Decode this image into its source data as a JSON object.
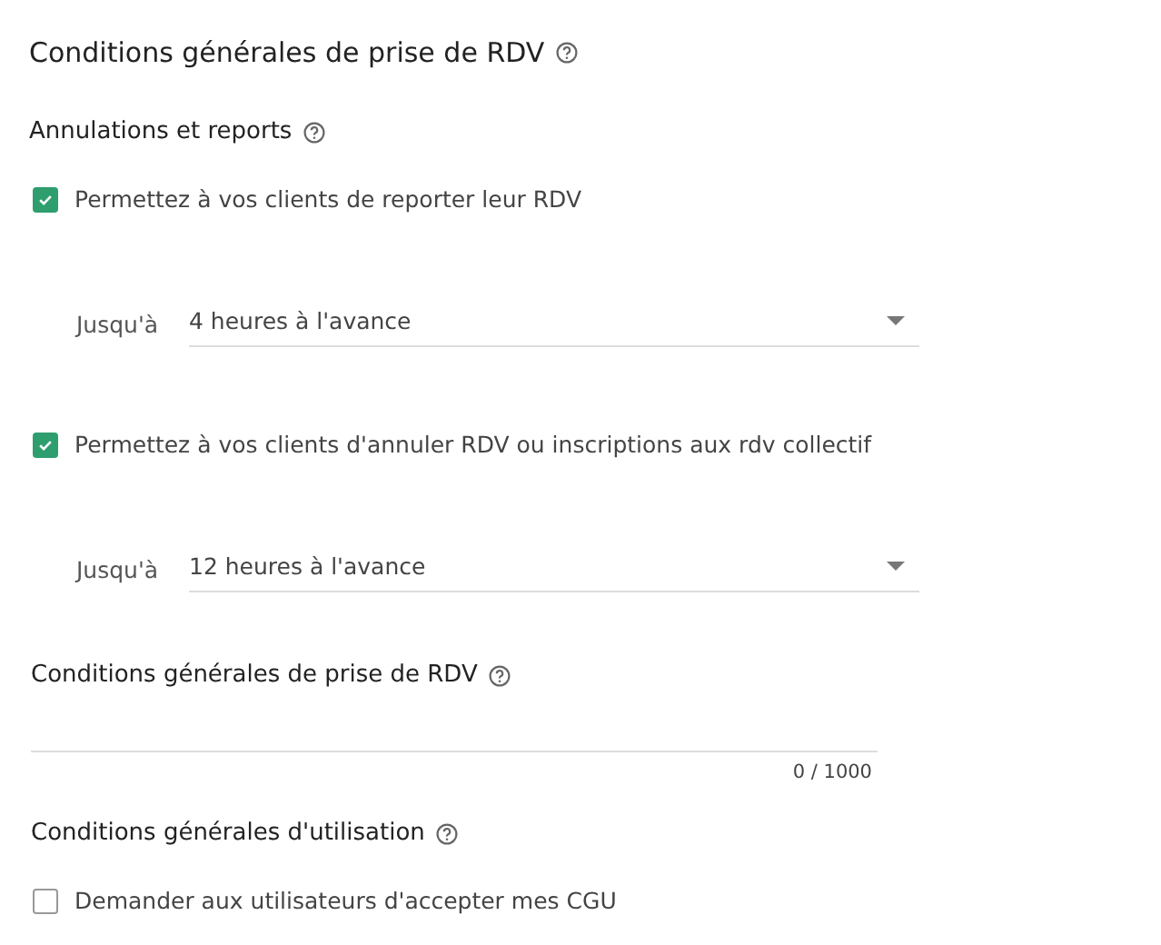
{
  "title": "Conditions générales de prise de RDV",
  "cancellations": {
    "heading": "Annulations et reports",
    "options": [
      {
        "label": "Permettez à vos clients de reporter leur RDV",
        "checked": true,
        "limit_label": "Jusqu'à",
        "limit_value": "4 heures à l'avance"
      },
      {
        "label": "Permettez à vos clients d'annuler RDV ou inscriptions aux rdv collectif",
        "checked": true,
        "limit_label": "Jusqu'à",
        "limit_value": "12 heures à l'avance"
      }
    ]
  },
  "terms": {
    "heading": "Conditions générales de prise de RDV",
    "counter": "0 / 1000"
  },
  "usage": {
    "heading": "Conditions générales d'utilisation",
    "checkbox": {
      "label": "Demander aux utilisateurs d'accepter mes CGU",
      "checked": false
    }
  }
}
